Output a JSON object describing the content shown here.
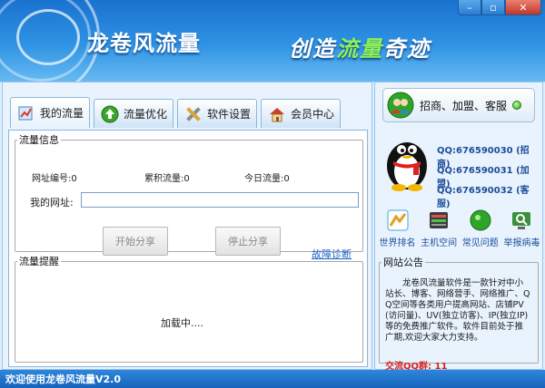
{
  "app": {
    "title": "龙卷风流量",
    "slogan_part1": "创造",
    "slogan_part2": "流量",
    "slogan_part3": "奇迹",
    "status_bar": "欢迎使用龙卷风流量V2.0"
  },
  "window_controls": {
    "minimize": "–",
    "maximize": "▫",
    "close": "✕"
  },
  "tabs": [
    {
      "label": "我的流量",
      "icon": "chart-icon"
    },
    {
      "label": "流量优化",
      "icon": "arrow-up-icon"
    },
    {
      "label": "软件设置",
      "icon": "tools-icon"
    },
    {
      "label": "会员中心",
      "icon": "house-icon"
    }
  ],
  "traffic_info": {
    "legend": "流量信息",
    "site_id_label": "网址编号:",
    "site_id_value": "0",
    "total_label": "累积流量:",
    "total_value": "0",
    "today_label": "今日流量:",
    "today_value": "0",
    "url_label": "我的网址:",
    "url_value": "",
    "start_button": "开始分享",
    "stop_button": "停止分享",
    "diagnose_link": "故障诊断"
  },
  "traffic_tip": {
    "legend": "流量提醒",
    "loading_text": "加载中...."
  },
  "partner": {
    "button_label": "招商、加盟、客服",
    "qq": [
      {
        "text": "QQ:676590030 (招商)"
      },
      {
        "text": "QQ:676590031 (加盟)"
      },
      {
        "text": "QQ:676590032 (客服)"
      }
    ]
  },
  "tools": [
    {
      "label": "世界排名",
      "icon": "world-rank-icon",
      "color": "#4aa3e6"
    },
    {
      "label": "主机空间",
      "icon": "server-icon",
      "color": "#4a4a4a"
    },
    {
      "label": "常见问题",
      "icon": "help-icon",
      "color": "#2fa32a"
    },
    {
      "label": "举报病毒",
      "icon": "report-virus-icon",
      "color": "#3c8f3c"
    }
  ],
  "notice": {
    "legend": "网站公告",
    "text": "龙卷风流量软件是一款针对中小站长、博客、网络营手、网络推广、QQ空间等各类用户提高网站、店铺PV(访问量)、UV(独立访客)、IP(独立IP)等的免费推广软件。软件目前处于推广期,欢迎大家大力支持。",
    "qq_group": "交流QQ群: 11"
  }
}
